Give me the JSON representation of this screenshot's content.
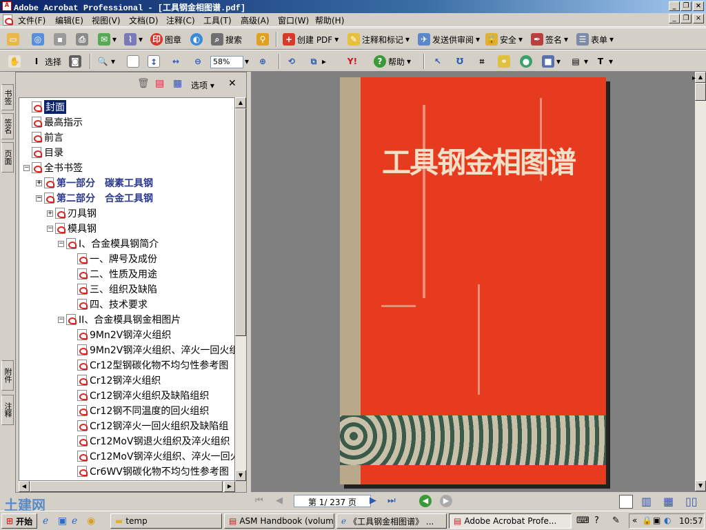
{
  "window": {
    "title": "Adobe Acrobat Professional - [工具钢金相图谱.pdf]"
  },
  "menubar": [
    "文件(F)",
    "编辑(E)",
    "视图(V)",
    "文档(D)",
    "注释(C)",
    "工具(T)",
    "高级(A)",
    "窗口(W)",
    "帮助(H)"
  ],
  "toolbar1": {
    "stamp": "图章",
    "search": "搜索",
    "create_pdf": "创建 PDF",
    "comment": "注释和标记",
    "send_review": "发送供审阅",
    "security": "安全",
    "sign": "签名",
    "forms": "表单"
  },
  "toolbar2": {
    "select": "选择",
    "zoom": "58%",
    "help": "帮助"
  },
  "left_tabs": [
    "书签",
    "签名",
    "页面",
    "附件",
    "注释"
  ],
  "panel": {
    "options": "选项"
  },
  "bookmarks": [
    {
      "label": "封面",
      "level": 0,
      "expander": "",
      "selected": true,
      "bold": false
    },
    {
      "label": "最高指示",
      "level": 0,
      "expander": "",
      "selected": false,
      "bold": false
    },
    {
      "label": "前言",
      "level": 0,
      "expander": "",
      "selected": false,
      "bold": false
    },
    {
      "label": "目录",
      "level": 0,
      "expander": "",
      "selected": false,
      "bold": false
    },
    {
      "label": "全书书签",
      "level": 0,
      "expander": "−",
      "selected": false,
      "bold": false
    },
    {
      "label": "第一部分　碳素工具钢",
      "level": 1,
      "expander": "+",
      "selected": false,
      "bold": true
    },
    {
      "label": "第二部分　合金工具钢",
      "level": 1,
      "expander": "−",
      "selected": false,
      "bold": true
    },
    {
      "label": "刃具钢",
      "level": 2,
      "expander": "+",
      "selected": false,
      "bold": false
    },
    {
      "label": "模具钢",
      "level": 2,
      "expander": "−",
      "selected": false,
      "bold": false
    },
    {
      "label": "I、合金模具钢简介",
      "level": 3,
      "expander": "−",
      "selected": false,
      "bold": false
    },
    {
      "label": "一、牌号及成份",
      "level": 4,
      "expander": "",
      "selected": false,
      "bold": false
    },
    {
      "label": "二、性质及用途",
      "level": 4,
      "expander": "",
      "selected": false,
      "bold": false
    },
    {
      "label": "三、组织及缺陷",
      "level": 4,
      "expander": "",
      "selected": false,
      "bold": false
    },
    {
      "label": "四、技术要求",
      "level": 4,
      "expander": "",
      "selected": false,
      "bold": false
    },
    {
      "label": "II、合金模具钢金相图片",
      "level": 3,
      "expander": "−",
      "selected": false,
      "bold": false
    },
    {
      "label": "9Mn2V钢淬火组织",
      "level": 4,
      "expander": "",
      "selected": false,
      "bold": false
    },
    {
      "label": "9Mn2V钢淬火组织、淬火一回火组",
      "level": 4,
      "expander": "",
      "selected": false,
      "bold": false
    },
    {
      "label": "Cr12型钢碳化物不均匀性参考图",
      "level": 4,
      "expander": "",
      "selected": false,
      "bold": false
    },
    {
      "label": "Cr12钢淬火组织",
      "level": 4,
      "expander": "",
      "selected": false,
      "bold": false
    },
    {
      "label": "Cr12钢淬火组织及缺陷组织",
      "level": 4,
      "expander": "",
      "selected": false,
      "bold": false
    },
    {
      "label": "Cr12钢不同温度的回火组织",
      "level": 4,
      "expander": "",
      "selected": false,
      "bold": false
    },
    {
      "label": "Cr12钢淬火一回火组织及缺陷组",
      "level": 4,
      "expander": "",
      "selected": false,
      "bold": false
    },
    {
      "label": "Cr12MoV钢退火组织及淬火组织",
      "level": 4,
      "expander": "",
      "selected": false,
      "bold": false
    },
    {
      "label": "Cr12MoV钢淬火组织、淬火一回火",
      "level": 4,
      "expander": "",
      "selected": false,
      "bold": false
    },
    {
      "label": "Cr6WV钢碳化物不均匀性参考图",
      "level": 4,
      "expander": "",
      "selected": false,
      "bold": false
    }
  ],
  "document": {
    "cover_title": "工具钢金相图谱"
  },
  "navigation": {
    "page_display": "第 1/ 237 页"
  },
  "taskbar": {
    "start": "开始",
    "items": [
      "temp",
      "ASM Handbook (volum...",
      "《工具钢金相图谱》 ...",
      "Adobe Acrobat Profe..."
    ],
    "clock": "10:57"
  },
  "watermark": "土建网"
}
